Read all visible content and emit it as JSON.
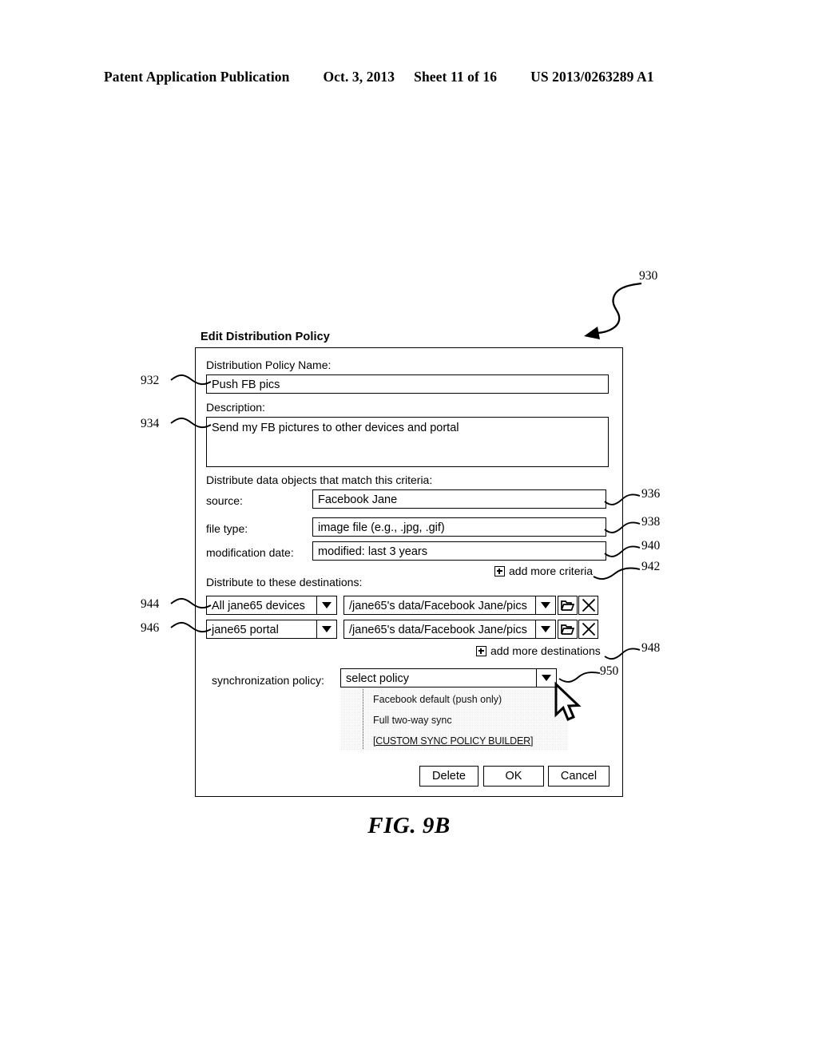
{
  "page_header": {
    "publication": "Patent Application Publication",
    "date": "Oct. 3, 2013",
    "sheet": "Sheet 11 of 16",
    "patent_number": "US 2013/0263289 A1"
  },
  "figure": {
    "caption": "FIG. 9B",
    "ref_930": "930"
  },
  "dialog": {
    "title": "Edit Distribution Policy",
    "policy_name": {
      "label": "Distribution Policy Name:",
      "value": "Push FB pics",
      "ref": "932"
    },
    "description": {
      "label": "Description:",
      "value": "Send my FB pictures to other devices and portal",
      "ref": "934"
    },
    "criteria": {
      "heading": "Distribute data objects that match this criteria:",
      "rows": [
        {
          "label": "source:",
          "value": "Facebook Jane",
          "ref": "936"
        },
        {
          "label": "file type:",
          "value": "image file (e.g., .jpg, .gif)",
          "ref": "938"
        },
        {
          "label": "modification date:",
          "value": "modified: last 3 years",
          "ref": "940"
        }
      ],
      "add_more": "add more criteria",
      "add_more_ref": "942",
      "add_icon": "plus-box-icon"
    },
    "destinations": {
      "heading": "Distribute to these destinations:",
      "rows": [
        {
          "target": "All jane65 devices",
          "path": "/jane65's data/Facebook Jane/pics",
          "ref": "944",
          "browse_icon": "folder-icon",
          "remove_icon": "close-x-icon"
        },
        {
          "target": "jane65 portal",
          "path": "/jane65's data/Facebook Jane/pics",
          "ref": "946",
          "browse_icon": "folder-icon",
          "remove_icon": "close-x-icon"
        }
      ],
      "add_more": "add more destinations",
      "add_more_ref": "948",
      "add_icon": "plus-box-icon"
    },
    "sync_policy": {
      "label": "synchronization policy:",
      "selected": "select policy",
      "ref": "950",
      "options": [
        "Facebook default (push only)",
        "Full two-way sync",
        "[CUSTOM SYNC POLICY BUILDER]"
      ]
    },
    "buttons": {
      "delete": "Delete",
      "ok": "OK",
      "cancel": "Cancel"
    }
  },
  "cursor": {
    "icon": "mouse-pointer-icon"
  },
  "colors": {
    "ink": "#000000",
    "paper": "#ffffff",
    "menu_bg": "#e9e9e9"
  }
}
